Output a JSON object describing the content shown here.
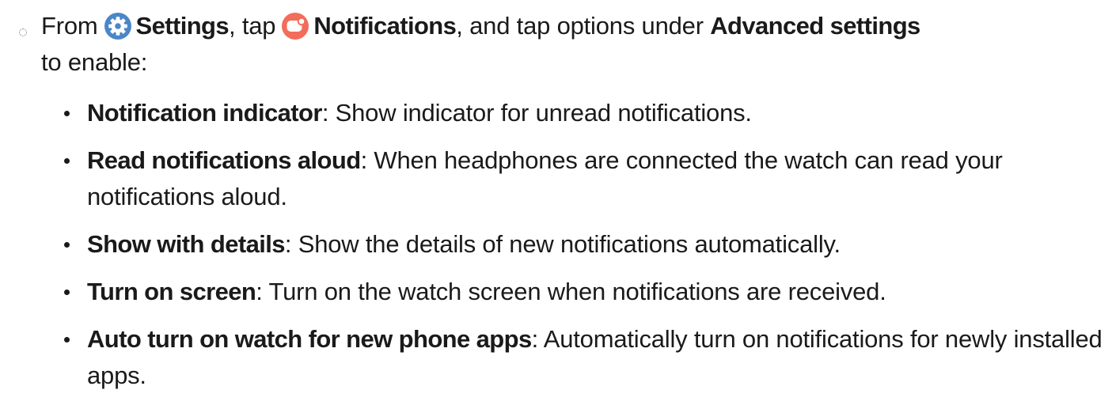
{
  "instruction": {
    "from_text": "From",
    "settings_icon": "settings-gear-icon",
    "settings_label": "Settings",
    "comma_tap_text": ", tap",
    "notifications_icon": "notifications-icon",
    "notifications_label": "Notifications",
    "middle_text": ", and tap options under",
    "advanced_label": "Advanced settings",
    "end_text": "to enable:"
  },
  "options": [
    {
      "term": "Notification indicator",
      "separator": ":",
      "description": "Show indicator for unread notifications."
    },
    {
      "term": "Read notifications aloud",
      "separator": ":",
      "description": "When headphones are connected the watch can read your notifications aloud."
    },
    {
      "term": "Show with details",
      "separator": ":",
      "description": "Show the details of new notifications automatically."
    },
    {
      "term": "Turn on screen",
      "separator": ":",
      "description": "Turn on the watch screen when notifications are received."
    },
    {
      "term": "Auto turn on watch for new phone apps",
      "separator": ":",
      "description": "Automatically turn on notifications for newly installed apps."
    }
  ],
  "colors": {
    "settings_icon_bg": "#4a86c8",
    "notifications_icon_bg": "#f26d5b",
    "text": "#1a1a1a"
  }
}
